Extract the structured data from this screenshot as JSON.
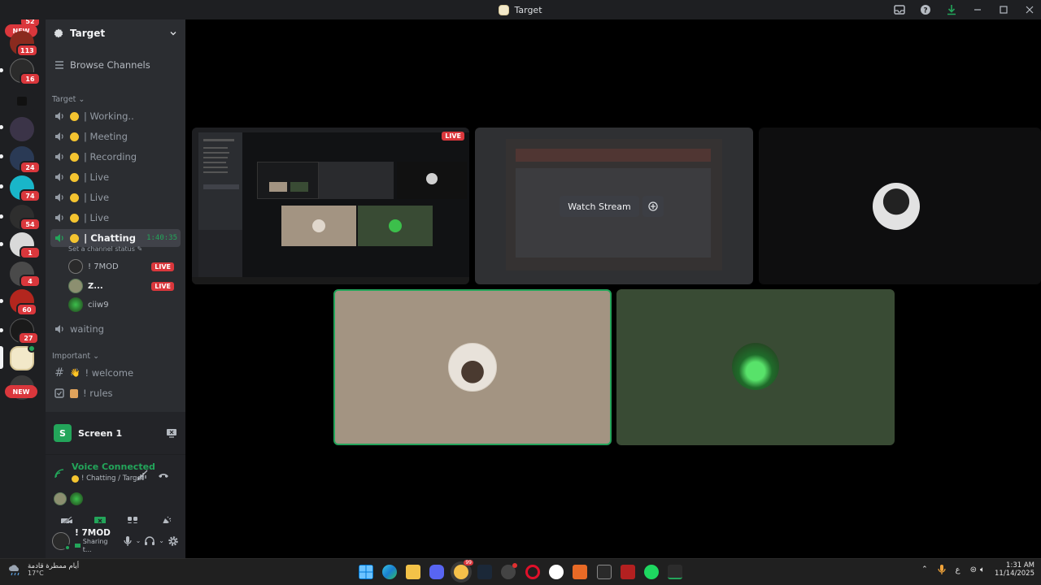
{
  "window": {
    "title": "Target"
  },
  "rail": {
    "top_badge": "52",
    "new_top": "NEW",
    "new_bottom": "NEW",
    "badges": [
      "113",
      "16",
      "24",
      "74",
      "54",
      "1",
      "4",
      "60",
      "27"
    ]
  },
  "guild": {
    "name": "Target",
    "browse": "Browse Channels"
  },
  "categories": {
    "target": "Target",
    "important": "Important"
  },
  "channels": [
    {
      "label": "| Working.."
    },
    {
      "label": "| Meeting"
    },
    {
      "label": "| Recording"
    },
    {
      "label": "| Live"
    },
    {
      "label": "| Live"
    },
    {
      "label": "| Live"
    }
  ],
  "active_channel": {
    "label": "| Chatting",
    "timer": "1:40:35",
    "status": "Set a channel status"
  },
  "voice_users": [
    {
      "name": "! 7MOD",
      "badge": "LIVE"
    },
    {
      "name": "Z...",
      "badge": "LIVE"
    },
    {
      "name": "ciiw9",
      "badge": ""
    }
  ],
  "waiting": {
    "label": "waiting"
  },
  "text_channels": [
    {
      "label": "! welcome"
    },
    {
      "label": "! rules"
    }
  ],
  "screen_panel": {
    "letter": "S",
    "label": "Screen 1"
  },
  "voice_panel": {
    "status": "Voice Connected",
    "location": "! Chatting / Target"
  },
  "user": {
    "name": "! 7MOD",
    "status": "Sharing t..."
  },
  "stage": {
    "watch_stream": "Watch Stream",
    "live_badge": "LIVE",
    "mini_watch": "Watch Stream"
  },
  "taskbar": {
    "weather_text": "أيام ممطرة قادمة",
    "weather_temp": "17°C",
    "spotify_badge": "99",
    "lang": "ع",
    "time": "1:31 AM",
    "date": "11/14/2025"
  },
  "colors": {
    "accent_green": "#23a55a",
    "live_red": "#da373c",
    "tile_beige": "#a39482",
    "tile_green": "#394b34"
  }
}
